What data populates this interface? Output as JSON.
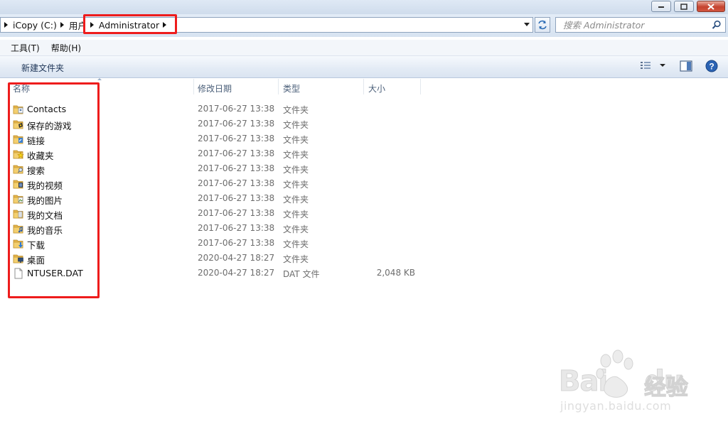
{
  "window": {
    "buttons": {
      "minimize": "minimize-icon",
      "maximize": "maximize-icon",
      "close": "close-icon"
    }
  },
  "address_bar": {
    "crumbs": [
      "iCopy (C:)",
      "用户",
      "Administrator"
    ]
  },
  "search": {
    "placeholder": "搜索 Administrator"
  },
  "menu": {
    "items": [
      "工具(T)",
      "帮助(H)"
    ]
  },
  "toolbar": {
    "new_folder_label": "新建文件夹"
  },
  "columns": {
    "name": "名称",
    "modified": "修改日期",
    "type": "类型",
    "size": "大小"
  },
  "files": [
    {
      "name": "Contacts",
      "modified": "2017-06-27 13:38",
      "type": "文件夹",
      "size": "",
      "icon": "contacts-folder-icon"
    },
    {
      "name": "保存的游戏",
      "modified": "2017-06-27 13:38",
      "type": "文件夹",
      "size": "",
      "icon": "saved-games-folder-icon"
    },
    {
      "name": "链接",
      "modified": "2017-06-27 13:38",
      "type": "文件夹",
      "size": "",
      "icon": "links-folder-icon"
    },
    {
      "name": "收藏夹",
      "modified": "2017-06-27 13:38",
      "type": "文件夹",
      "size": "",
      "icon": "favorites-folder-icon"
    },
    {
      "name": "搜索",
      "modified": "2017-06-27 13:38",
      "type": "文件夹",
      "size": "",
      "icon": "searches-folder-icon"
    },
    {
      "name": "我的视频",
      "modified": "2017-06-27 13:38",
      "type": "文件夹",
      "size": "",
      "icon": "videos-folder-icon"
    },
    {
      "name": "我的图片",
      "modified": "2017-06-27 13:38",
      "type": "文件夹",
      "size": "",
      "icon": "pictures-folder-icon"
    },
    {
      "name": "我的文档",
      "modified": "2017-06-27 13:38",
      "type": "文件夹",
      "size": "",
      "icon": "documents-folder-icon"
    },
    {
      "name": "我的音乐",
      "modified": "2017-06-27 13:38",
      "type": "文件夹",
      "size": "",
      "icon": "music-folder-icon"
    },
    {
      "name": "下载",
      "modified": "2017-06-27 13:38",
      "type": "文件夹",
      "size": "",
      "icon": "downloads-folder-icon"
    },
    {
      "name": "桌面",
      "modified": "2020-04-27 18:27",
      "type": "文件夹",
      "size": "",
      "icon": "desktop-folder-icon"
    },
    {
      "name": "NTUSER.DAT",
      "modified": "2020-04-27 18:27",
      "type": "DAT 文件",
      "size": "2,048 KB",
      "icon": "file-icon"
    }
  ],
  "watermark": {
    "brand": "Bai",
    "brand2": "du",
    "cn": "经验",
    "url": "jingyan.baidu.com"
  },
  "colors": {
    "highlight": "#ee1c1c",
    "folder": "#e8b84a",
    "toolbar_text": "#1e3557"
  }
}
